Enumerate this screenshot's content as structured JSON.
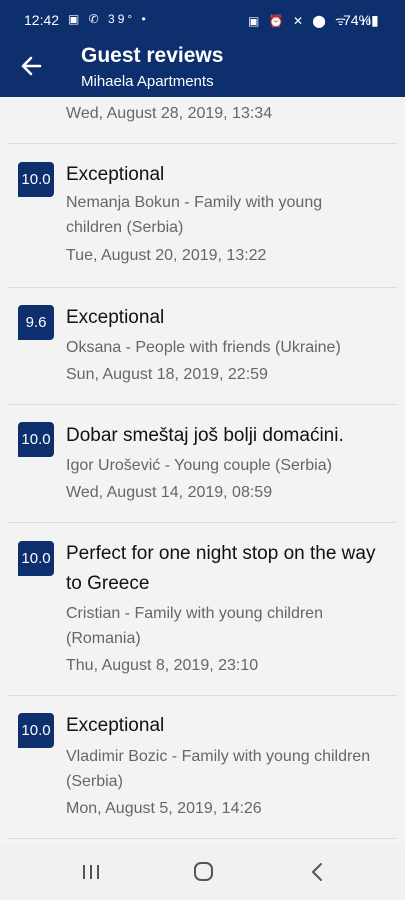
{
  "status_bar": {
    "time": "12:42",
    "left_icons": "▣ ✆ 39° •",
    "right_icons": "▣ ⏰ ✕ ⬤ ᯤ .ıl",
    "battery": "74%▮"
  },
  "app_bar": {
    "title": "Guest reviews",
    "subtitle": "Mihaela Apartments",
    "back_icon": "arrow-left"
  },
  "partial_date": "Wed, August 28, 2019, 13:34",
  "reviews": [
    {
      "score": "10.0",
      "title": "Exceptional",
      "author": "Nemanja Bokun - Family with young children (Serbia)",
      "date": "Tue, August 20, 2019, 13:22"
    },
    {
      "score": "9.6",
      "title": "Exceptional",
      "author": "Oksana  - People with friends (Ukraine)",
      "date": "Sun, August 18, 2019, 22:59"
    },
    {
      "score": "10.0",
      "title": "Dobar smeštaj još bolji domaćini.",
      "author": "Igor Urošević - Young couple (Serbia)",
      "date": "Wed, August 14, 2019, 08:59"
    },
    {
      "score": "10.0",
      "title": "Perfect for one night stop on the way to Greece",
      "author": "Cristian - Family with young children (Romania)",
      "date": "Thu, August 8, 2019, 23:10"
    },
    {
      "score": "10.0",
      "title": "Exceptional",
      "author": "Vladimir Bozic - Family with young children (Serbia)",
      "date": "Mon, August 5, 2019, 14:26"
    }
  ],
  "nav_bar": {
    "recents_icon": "recents",
    "home_icon": "home",
    "back_icon": "back"
  },
  "colors": {
    "brand": "#0d2f6e",
    "background": "#f3f3f3",
    "secondary_text": "#666666"
  }
}
